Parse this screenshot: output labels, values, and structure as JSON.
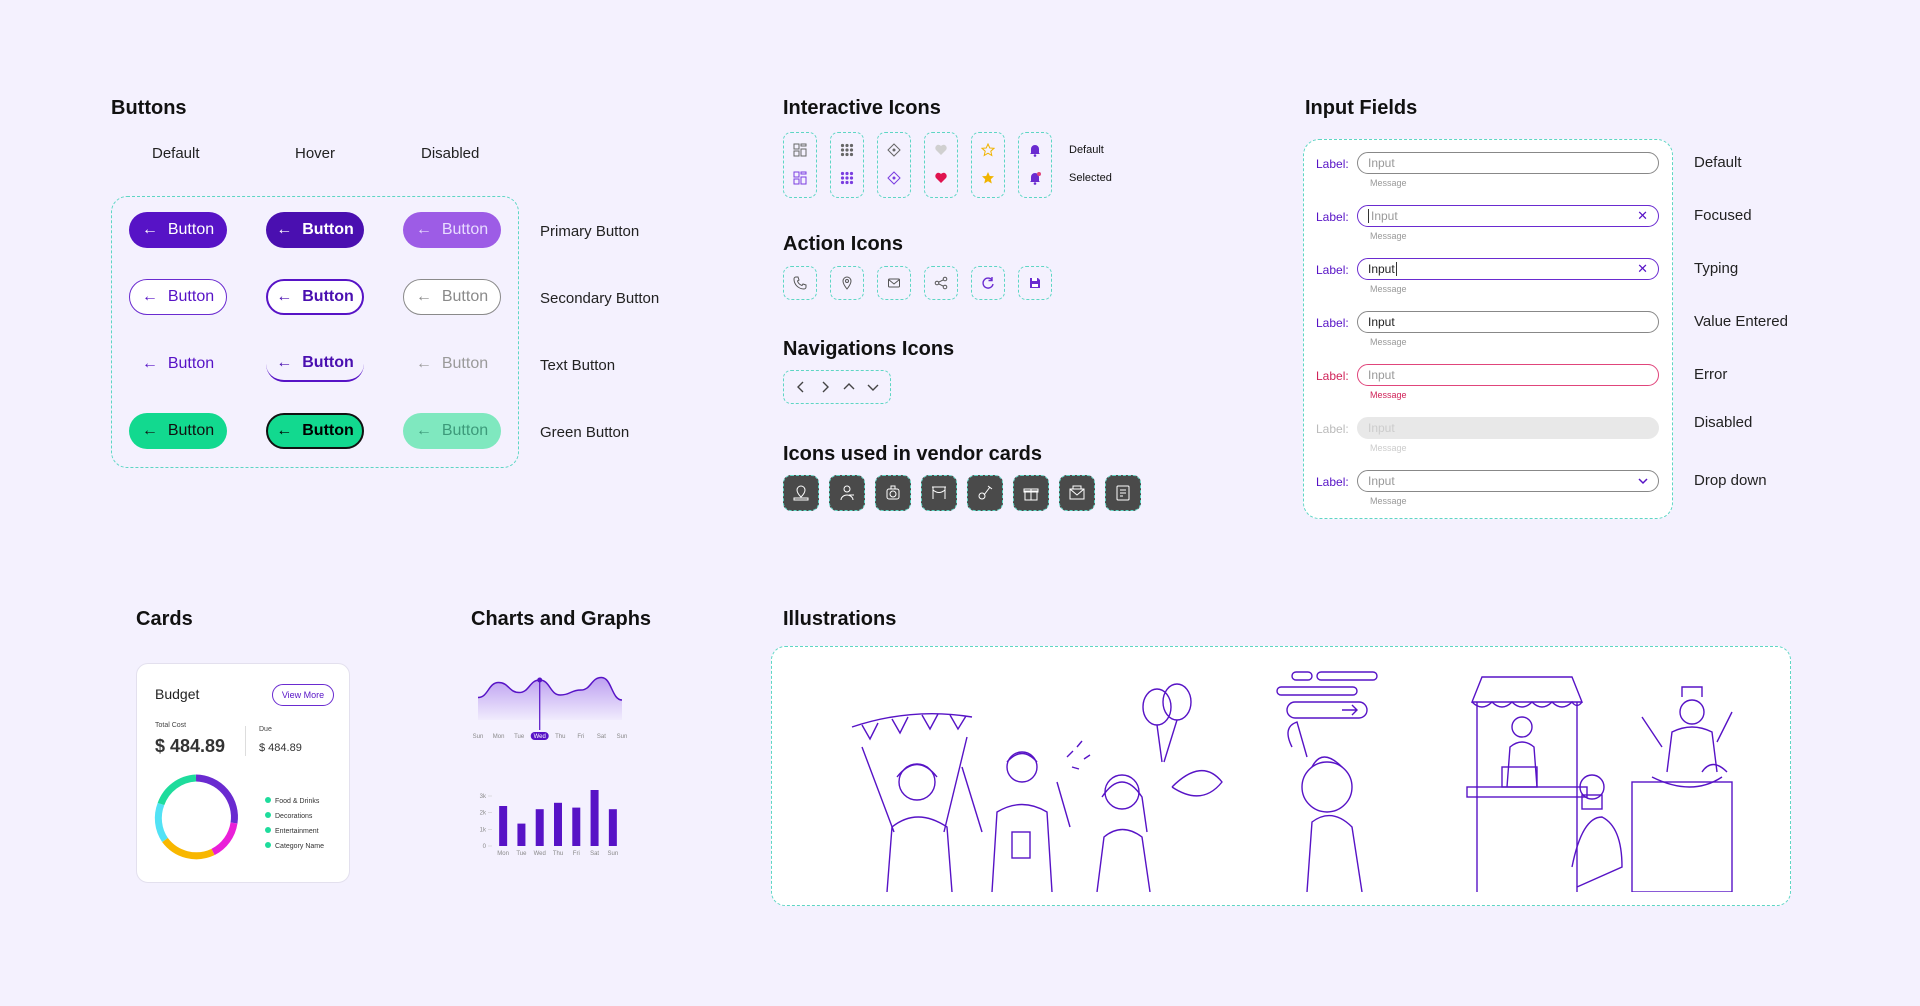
{
  "buttons": {
    "title": "Buttons",
    "columns": [
      "Default",
      "Hover",
      "Disabled"
    ],
    "label": "Button",
    "rows": [
      "Primary Button",
      "Secondary Button",
      "Text Button",
      "Green Button"
    ]
  },
  "interactive_icons": {
    "title": "Interactive Icons",
    "state_default": "Default",
    "state_selected": "Selected",
    "icons": [
      "layout-icon",
      "grid-icon",
      "move-icon",
      "heart-icon",
      "star-icon",
      "bell-icon"
    ]
  },
  "action_icons": {
    "title": "Action Icons",
    "icons": [
      "phone-icon",
      "location-pin-icon",
      "mail-icon",
      "share-icon",
      "refresh-icon",
      "save-icon"
    ]
  },
  "navigation_icons": {
    "title": "Navigations Icons",
    "icons": [
      "chevron-left-icon",
      "chevron-right-icon",
      "chevron-up-icon",
      "chevron-down-icon"
    ]
  },
  "vendor_icons": {
    "title": "Icons used in vendor cards",
    "icons": [
      "venue-icon",
      "caterer-icon",
      "photographer-icon",
      "decorator-icon",
      "music-icon",
      "gift-icon",
      "invitation-icon",
      "planner-icon"
    ]
  },
  "input_fields": {
    "title": "Input Fields",
    "label": "Label:",
    "message": "Message",
    "placeholder": "Input",
    "states": [
      "Default",
      "Focused",
      "Typing",
      "Value Entered",
      "Error",
      "Disabled",
      "Drop down"
    ]
  },
  "cards": {
    "title": "Cards",
    "card_title": "Budget",
    "view_more": "View More",
    "total_cost_label": "Total Cost",
    "total_cost_value": "$ 484.89",
    "due_label": "Due",
    "due_value": "$ 484.89",
    "legend": [
      "Food & Drinks",
      "Decorations",
      "Entertainment",
      "Category Name"
    ]
  },
  "charts": {
    "title": "Charts and Graphs"
  },
  "illustrations": {
    "title": "Illustrations"
  },
  "colors": {
    "primary": "#5713c6",
    "green": "#12d98f",
    "error": "#e0457b",
    "dashed_border": "#5ed6c4",
    "background": "#f4f1fe"
  },
  "chart_data": [
    {
      "type": "area",
      "x": [
        "Sun",
        "Mon",
        "Tue",
        "Wed",
        "Thu",
        "Fri",
        "Sat",
        "Sun"
      ],
      "values": [
        18,
        30,
        22,
        32,
        20,
        24,
        34,
        16
      ],
      "highlight": "Wed",
      "title": "",
      "xlabel": "",
      "ylabel": ""
    },
    {
      "type": "bar",
      "categories": [
        "Mon",
        "Tue",
        "Wed",
        "Thu",
        "Fri",
        "Sat",
        "Sun"
      ],
      "values": [
        2.5,
        1.4,
        2.3,
        2.7,
        2.4,
        3.5,
        2.3
      ],
      "yticks": [
        "0",
        "1k",
        "2k",
        "3k"
      ],
      "ylim": [
        0,
        3.5
      ],
      "title": "",
      "xlabel": "",
      "ylabel": ""
    }
  ]
}
